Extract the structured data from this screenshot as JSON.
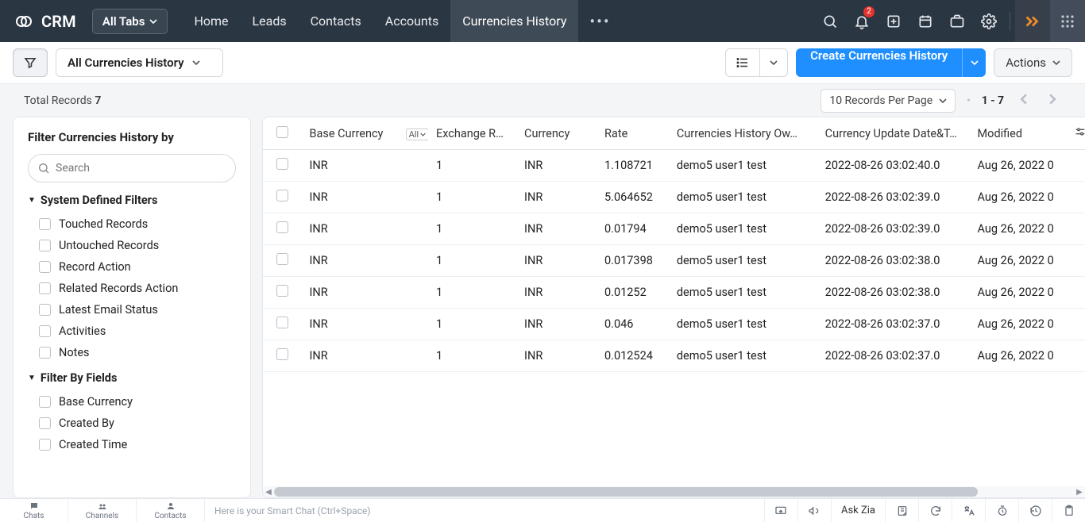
{
  "brand": "CRM",
  "tabs_button": "All Tabs",
  "nav": [
    "Home",
    "Leads",
    "Contacts",
    "Accounts",
    "Currencies History"
  ],
  "nav_active_index": 4,
  "notif_badge": "2",
  "toolbar": {
    "view_label": "All Currencies History",
    "create_label": "Create Currencies History",
    "actions_label": "Actions"
  },
  "subheader": {
    "total_prefix": "Total Records ",
    "total_count": "7",
    "perpage": "10 Records Per Page",
    "range": "1 - 7"
  },
  "filters": {
    "title": "Filter Currencies History by",
    "search_placeholder": "Search",
    "group1_title": "System Defined Filters",
    "group1_items": [
      "Touched Records",
      "Untouched Records",
      "Record Action",
      "Related Records Action",
      "Latest Email Status",
      "Activities",
      "Notes"
    ],
    "group2_title": "Filter By Fields",
    "group2_items": [
      "Base Currency",
      "Created By",
      "Created Time"
    ]
  },
  "table": {
    "columns": [
      "Base Currency",
      "Exchange R…",
      "Currency",
      "Rate",
      "Currencies History Ow…",
      "Currency Update Date&T…",
      "Modified"
    ],
    "all_pill": "All",
    "rows": [
      {
        "base": "INR",
        "exch": "1",
        "curr": "INR",
        "rate": "1.108721",
        "owner": "demo5 user1 test",
        "update": "2022-08-26 03:02:40.0",
        "modified": "Aug 26, 2022 0"
      },
      {
        "base": "INR",
        "exch": "1",
        "curr": "INR",
        "rate": "5.064652",
        "owner": "demo5 user1 test",
        "update": "2022-08-26 03:02:39.0",
        "modified": "Aug 26, 2022 0"
      },
      {
        "base": "INR",
        "exch": "1",
        "curr": "INR",
        "rate": "0.01794",
        "owner": "demo5 user1 test",
        "update": "2022-08-26 03:02:39.0",
        "modified": "Aug 26, 2022 0"
      },
      {
        "base": "INR",
        "exch": "1",
        "curr": "INR",
        "rate": "0.017398",
        "owner": "demo5 user1 test",
        "update": "2022-08-26 03:02:38.0",
        "modified": "Aug 26, 2022 0"
      },
      {
        "base": "INR",
        "exch": "1",
        "curr": "INR",
        "rate": "0.01252",
        "owner": "demo5 user1 test",
        "update": "2022-08-26 03:02:38.0",
        "modified": "Aug 26, 2022 0"
      },
      {
        "base": "INR",
        "exch": "1",
        "curr": "INR",
        "rate": "0.046",
        "owner": "demo5 user1 test",
        "update": "2022-08-26 03:02:37.0",
        "modified": "Aug 26, 2022 0"
      },
      {
        "base": "INR",
        "exch": "1",
        "curr": "INR",
        "rate": "0.012524",
        "owner": "demo5 user1 test",
        "update": "2022-08-26 03:02:37.0",
        "modified": "Aug 26, 2022 0"
      }
    ]
  },
  "bottombar": {
    "tabs": [
      "Chats",
      "Channels",
      "Contacts"
    ],
    "smartchat": "Here is your Smart Chat (Ctrl+Space)",
    "ask_zia": "Ask Zia"
  }
}
